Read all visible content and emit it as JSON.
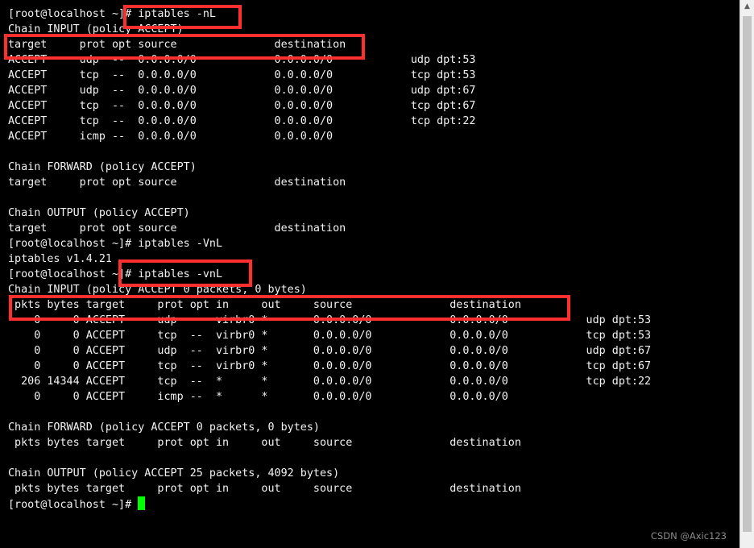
{
  "terminal": {
    "lines": [
      "[root@localhost ~]# iptables -nL",
      "Chain INPUT (policy ACCEPT)",
      "target     prot opt source               destination",
      "ACCEPT     udp  --  0.0.0.0/0            0.0.0.0/0            udp dpt:53",
      "ACCEPT     tcp  --  0.0.0.0/0            0.0.0.0/0            tcp dpt:53",
      "ACCEPT     udp  --  0.0.0.0/0            0.0.0.0/0            udp dpt:67",
      "ACCEPT     tcp  --  0.0.0.0/0            0.0.0.0/0            tcp dpt:67",
      "ACCEPT     tcp  --  0.0.0.0/0            0.0.0.0/0            tcp dpt:22",
      "ACCEPT     icmp --  0.0.0.0/0            0.0.0.0/0",
      "",
      "Chain FORWARD (policy ACCEPT)",
      "target     prot opt source               destination",
      "",
      "Chain OUTPUT (policy ACCEPT)",
      "target     prot opt source               destination",
      "[root@localhost ~]# iptables -VnL",
      "iptables v1.4.21",
      "[root@localhost ~]# iptables -vnL",
      "Chain INPUT (policy ACCEPT 0 packets, 0 bytes)",
      " pkts bytes target     prot opt in     out     source               destination",
      "    0     0 ACCEPT     udp  --  virbr0 *       0.0.0.0/0            0.0.0.0/0            udp dpt:53",
      "    0     0 ACCEPT     tcp  --  virbr0 *       0.0.0.0/0            0.0.0.0/0            tcp dpt:53",
      "    0     0 ACCEPT     udp  --  virbr0 *       0.0.0.0/0            0.0.0.0/0            udp dpt:67",
      "    0     0 ACCEPT     tcp  --  virbr0 *       0.0.0.0/0            0.0.0.0/0            tcp dpt:67",
      "  206 14344 ACCEPT     tcp  --  *      *       0.0.0.0/0            0.0.0.0/0            tcp dpt:22",
      "    0     0 ACCEPT     icmp --  *      *       0.0.0.0/0            0.0.0.0/0",
      "",
      "Chain FORWARD (policy ACCEPT 0 packets, 0 bytes)",
      " pkts bytes target     prot opt in     out     source               destination",
      "",
      "Chain OUTPUT (policy ACCEPT 25 packets, 4092 bytes)",
      " pkts bytes target     prot opt in     out     source               destination"
    ],
    "prompt": "[root@localhost ~]# ",
    "cursor_color": "#00ff00",
    "background": "#000000",
    "foreground": "#f2f2f2"
  },
  "highlight_color": "#ff2f2f",
  "watermark": "CSDN @Axic123"
}
